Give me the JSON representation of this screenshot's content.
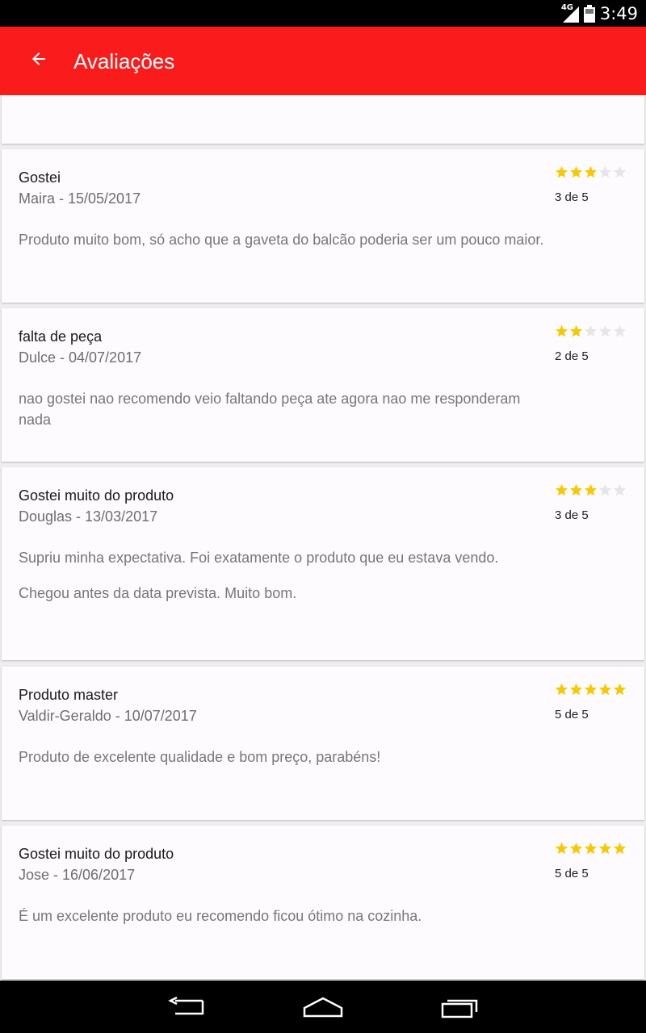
{
  "status_bar": {
    "network": "4G",
    "time": "3:49"
  },
  "app_bar": {
    "title": "Avaliações",
    "back_icon": "arrow-back-icon",
    "color": "#fa1c1c"
  },
  "colors": {
    "star_filled": "#f8c800",
    "star_empty": "#e6e6e6"
  },
  "reviews": [
    {
      "title": "Gostei",
      "author_date": "Maira - 15/05/2017",
      "body": [
        "Produto muito bom, só acho que a gaveta do balcão poderia ser um pouco maior."
      ],
      "rating": 3,
      "rating_text": "3 de 5"
    },
    {
      "title": "falta de peça",
      "author_date": "Dulce - 04/07/2017",
      "body": [
        "nao gostei nao recomendo veio faltando peça ate agora nao me responderam nada"
      ],
      "rating": 2,
      "rating_text": "2 de 5"
    },
    {
      "title": "Gostei muito do produto",
      "author_date": "Douglas - 13/03/2017",
      "body": [
        "Supriu minha expectativa. Foi exatamente o produto que eu estava vendo.",
        "Chegou antes da data prevista. Muito bom."
      ],
      "rating": 3,
      "rating_text": "3 de 5"
    },
    {
      "title": "Produto master",
      "author_date": "Valdir-Geraldo - 10/07/2017",
      "body": [
        "Produto de excelente qualidade e bom preço, parabéns!"
      ],
      "rating": 5,
      "rating_text": "5 de 5"
    },
    {
      "title": "Gostei muito do produto",
      "author_date": "Jose - 16/06/2017",
      "body": [
        "É um excelente produto eu recomendo ficou ótimo na cozinha."
      ],
      "rating": 5,
      "rating_text": "5 de 5"
    }
  ],
  "nav_bar": {
    "back_icon": "nav-back-icon",
    "home_icon": "nav-home-icon",
    "recents_icon": "nav-recents-icon"
  }
}
